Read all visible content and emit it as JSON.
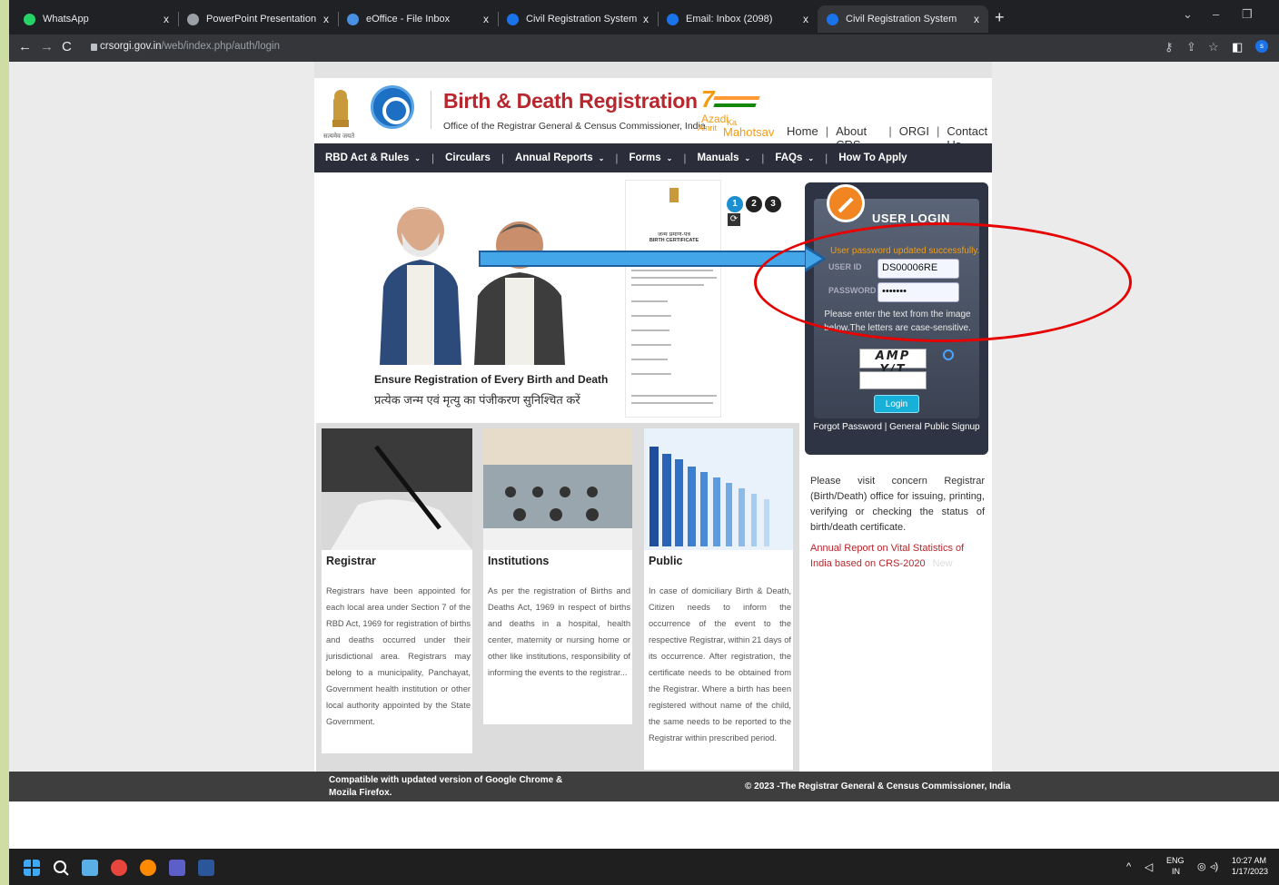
{
  "browser": {
    "tabs": [
      {
        "label": "WhatsApp",
        "color": "#25d366"
      },
      {
        "label": "PowerPoint Presentation",
        "color": "#9aa0a6"
      },
      {
        "label": "eOffice - File Inbox",
        "color": "#4a90e2"
      },
      {
        "label": "Civil Registration System",
        "color": "#1a73e8"
      },
      {
        "label": "Email: Inbox (2098)",
        "color": "#1a73e8"
      },
      {
        "label": "Civil Registration System",
        "color": "#1a73e8"
      }
    ],
    "close_glyph": "x",
    "new_tab_glyph": "+",
    "url_host": "crsorgi.gov.in",
    "url_path": "/web/index.php/auth/login",
    "profile_initial": "s"
  },
  "header": {
    "emblem_caption": "सत्यमेव जयते",
    "title": "Birth & Death Registration",
    "subtitle": "Office of the Registrar General & Census Commissioner, India",
    "azadi": {
      "line1": "Azadi",
      "ka": "Ka",
      "line3": "Amrit",
      "line4": "Mahotsav"
    },
    "links": [
      "Home",
      "About CRS",
      "ORGI",
      "Contact Us"
    ],
    "link_sep": "|"
  },
  "menu": [
    {
      "label": "RBD Act & Rules",
      "dropdown": true
    },
    {
      "label": "Circulars",
      "dropdown": false
    },
    {
      "label": "Annual Reports",
      "dropdown": true
    },
    {
      "label": "Forms",
      "dropdown": true
    },
    {
      "label": "Manuals",
      "dropdown": true
    },
    {
      "label": "FAQs",
      "dropdown": true
    },
    {
      "label": "How To Apply",
      "dropdown": false
    }
  ],
  "hero": {
    "caption_en": "Ensure Registration of Every Birth and Death",
    "caption_hi": "प्रत्येक जन्म एवं मृत्यु का पंजीकरण सुनिश्चित करें",
    "cert_title_hi": "जन्म प्रमाण-पत्र",
    "cert_title_en": "BIRTH CERTIFICATE",
    "slides": [
      "1",
      "2",
      "3"
    ]
  },
  "login": {
    "title": "USER LOGIN",
    "message": "User password updated successfully.",
    "userid_label": "USER ID",
    "userid_value": "DS00006RE",
    "password_label": "PASSWORD",
    "password_value": "•••••••",
    "note": "Please enter the text from the image below.The letters are case-sensitive.",
    "captcha_text": "AMP Y/T",
    "button": "Login",
    "links": "Forgot Password | General Public Signup"
  },
  "sidebar": {
    "visit_text": "Please visit concern Registrar (Birth/Death) office for issuing, printing, verifying or checking the status of birth/death certificate.",
    "annual_report": "Annual Report on Vital Statistics of India based on CRS-2020",
    "new_badge": "New"
  },
  "cards": [
    {
      "title": "Registrar",
      "text": "Registrars have been appointed for each local area under Section 7 of the RBD Act, 1969 for registration of births and deaths occurred under their jurisdictional area. Registrars may belong to a municipality, Panchayat, Government health institution or other local authority appointed by the State Government."
    },
    {
      "title": "Institutions",
      "text": "As per the registration of Births and Deaths Act, 1969 in respect of births and deaths in a hospital, health center, maternity or nursing home or other like institutions, responsibility of informing the events to the registrar..."
    },
    {
      "title": "Public",
      "text": "In case of domiciliary Birth & Death, Citizen needs to inform the occurrence of the event to the respective Registrar, within 21 days of its occurrence. After registration, the certificate needs to be obtained from the Registrar. Where a birth has been registered without name of the child, the same needs to be reported to the Registrar within prescribed period."
    }
  ],
  "footer": {
    "compat": "Compatible with updated version of Google Chrome & Mozila Firefox.",
    "copyright": "© 2023 -The Registrar General & Census Commissioner, India"
  },
  "taskbar": {
    "lang": "ENG",
    "region": "IN",
    "time": "10:27 AM",
    "date": "1/17/2023"
  },
  "colors": {
    "brand_red": "#b7272d",
    "menu_bg": "#2b2d3a",
    "login_bg": "#2e3443",
    "annotation_red": "#e60000",
    "arrow_blue": "#43a6e8"
  }
}
